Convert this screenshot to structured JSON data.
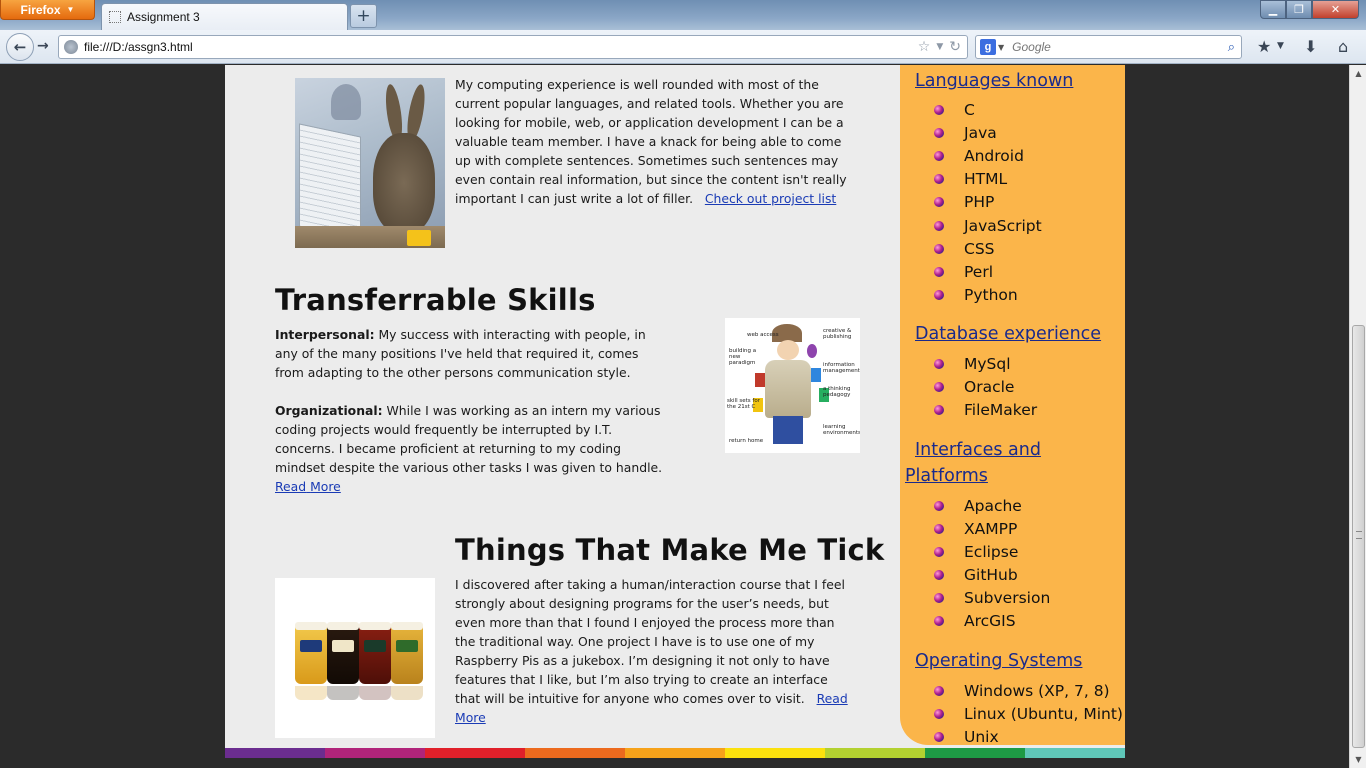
{
  "browser": {
    "menu_button": "Firefox",
    "tab_title": "Assignment 3",
    "new_tab": "+",
    "url": "file:///D:/assgn3.html",
    "search_engine_letter": "g",
    "search_placeholder": "Google"
  },
  "page": {
    "experience_text": "My computing experience is well rounded with most of the current popular languages, and related tools. Whether you are looking for mobile, web, or application development I can be a valuable team member. I have a knack for being able to come up with complete sentences. Sometimes such sentences may even contain real information, but since the content isn't really important I can just write a lot of filler.",
    "experience_link": "Check out project list",
    "skills_title": "Transferrable Skills",
    "interpersonal_label": "Interpersonal:",
    "interpersonal_text": "My success with interacting with people, in any of the many positions I've held that required it, comes from adapting to the other persons communication style.",
    "organizational_label": "Organizational:",
    "organizational_text": "While I was working as an intern my various coding projects would frequently be interrupted by I.T. concerns. I became proficient at returning to my coding mindset despite the various other tasks I was given to handle.",
    "read_more_1a": "Read",
    "read_more_1b": "More",
    "inspector_labels": [
      "web access",
      "creative & publishing",
      "building a new paradigm",
      "information management",
      "a thinking pedagogy",
      "skill sets for the 21st C",
      "learning environments",
      "return home"
    ],
    "tick_title": "Things That Make Me Tick",
    "tick_text": "I discovered after taking a human/interaction course that I feel strongly about designing programs for the user’s needs, but even more than that I found I enjoyed the process more than the traditional way. One project I have is to use one of my Raspberry Pis as a jukebox. I’m designing it not only to have features that I like, but I’m also trying to create an interface that will be intuitive for anyone who comes over to visit.",
    "read_more_2a": "Read",
    "read_more_2b": "More"
  },
  "sidebar": {
    "languages_heading": "Languages known",
    "languages": [
      "C",
      "Java",
      "Android",
      "HTML",
      "PHP",
      "JavaScript",
      "CSS",
      "Perl",
      "Python"
    ],
    "database_heading": "Database experience",
    "databases": [
      "MySql",
      "Oracle",
      "FileMaker"
    ],
    "interfaces_heading_1": "Interfaces and",
    "interfaces_heading_2": "Platforms",
    "interfaces": [
      "Apache",
      "XAMPP",
      "Eclipse",
      "GitHub",
      "Subversion",
      "ArcGIS"
    ],
    "os_heading": "Operating Systems",
    "systems": [
      "Windows (XP, 7, 8)",
      "Linux (Ubuntu, Mint)",
      "Unix"
    ]
  },
  "colors": {
    "sidebar_bg": "#fbb54a",
    "link": "#1a3bb5",
    "rainbow": [
      "#6b2d8f",
      "#b0247a",
      "#e0202a",
      "#ec6a1e",
      "#f6a21a",
      "#fbe10d",
      "#b3d130",
      "#1e9a45",
      "#5fc6b8"
    ]
  }
}
